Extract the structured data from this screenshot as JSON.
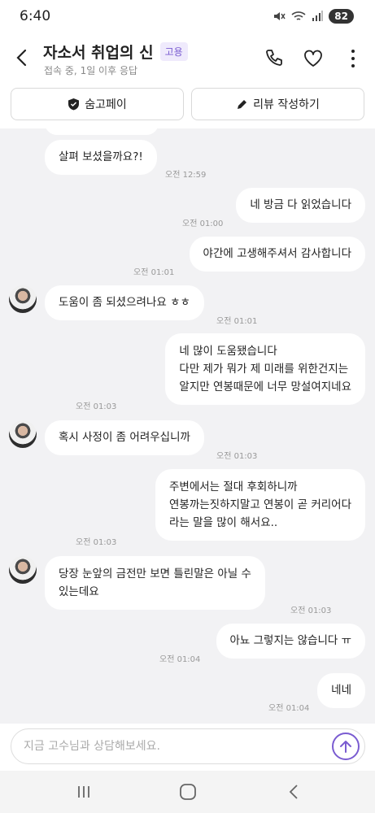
{
  "status": {
    "time": "6:40",
    "battery": "82"
  },
  "header": {
    "title": "자소서 취업의 신",
    "badge": "고용",
    "subtitle": "접속 중, 1일 이후 응답"
  },
  "actions": {
    "pay_label": "숨고페이",
    "review_label": "리뷰 작성하기"
  },
  "messages": [
    {
      "side": "in",
      "text": "살펴 보셨을까요?!",
      "time": "오전 12:59"
    },
    {
      "side": "out",
      "text": "네 방금 다 읽었습니다",
      "time": "오전 01:00"
    },
    {
      "side": "out",
      "text": "야간에 고생해주셔서 감사합니다",
      "time": "오전 01:01"
    },
    {
      "side": "in",
      "text": "도움이 좀 되셨으려나요 ㅎㅎ",
      "time": "오전 01:01"
    },
    {
      "side": "out",
      "lines": [
        "네 많이 도움됐습니다",
        "다만 제가 뭐가 제 미래를 위한건지는",
        "알지만 연봉때문에 너무 망설여지네요"
      ],
      "time": "오전 01:03"
    },
    {
      "side": "in",
      "text": "혹시 사정이 좀 어려우십니까",
      "time": "오전 01:03"
    },
    {
      "side": "out",
      "lines": [
        "주변에서는 절대 후회하니까",
        "연봉까는짓하지말고 연봉이 곧 커리어다",
        "라는 말을 많이 해서요.."
      ],
      "time": "오전 01:03"
    },
    {
      "side": "in",
      "lines": [
        "당장 눈앞의 금전만 보면 틀린말은 아닐 수",
        "있는데요"
      ],
      "time": "오전 01:03"
    },
    {
      "side": "out",
      "text": "아뇨 그렇지는 않습니다 ㅠ",
      "time": "오전 01:04"
    },
    {
      "side": "out",
      "text": "네네",
      "time": "오전 01:04"
    }
  ],
  "input": {
    "placeholder": "지금 고수님과 상담해보세요."
  },
  "colors": {
    "accent": "#7a5cd1",
    "chat_bg": "#f2f2f4"
  }
}
